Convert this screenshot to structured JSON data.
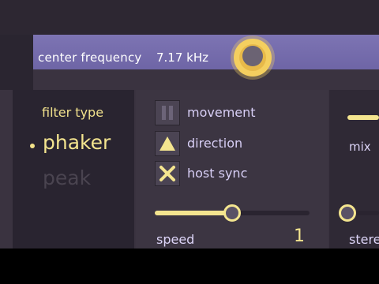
{
  "frequency": {
    "label": "center frequency",
    "value": "7.17 kHz"
  },
  "filter": {
    "title": "filter type",
    "options": [
      "phaker",
      "peak"
    ],
    "selected": "phaker"
  },
  "toggles": [
    {
      "label": "movement",
      "icon": "pause-icon",
      "state": "pause"
    },
    {
      "label": "direction",
      "icon": "triangle-up-icon",
      "state": "up"
    },
    {
      "label": "host sync",
      "icon": "x-icon",
      "state": "enabled"
    }
  ],
  "speed": {
    "label": "speed",
    "value": "1",
    "level": 0.5
  },
  "mix": {
    "label": "mix"
  },
  "stereo": {
    "label": "stere"
  },
  "colors": {
    "accent": "#f4e58f",
    "panel": "#3c3542",
    "freq_panel": "#7d74b3",
    "text": "#ddd5f8"
  }
}
